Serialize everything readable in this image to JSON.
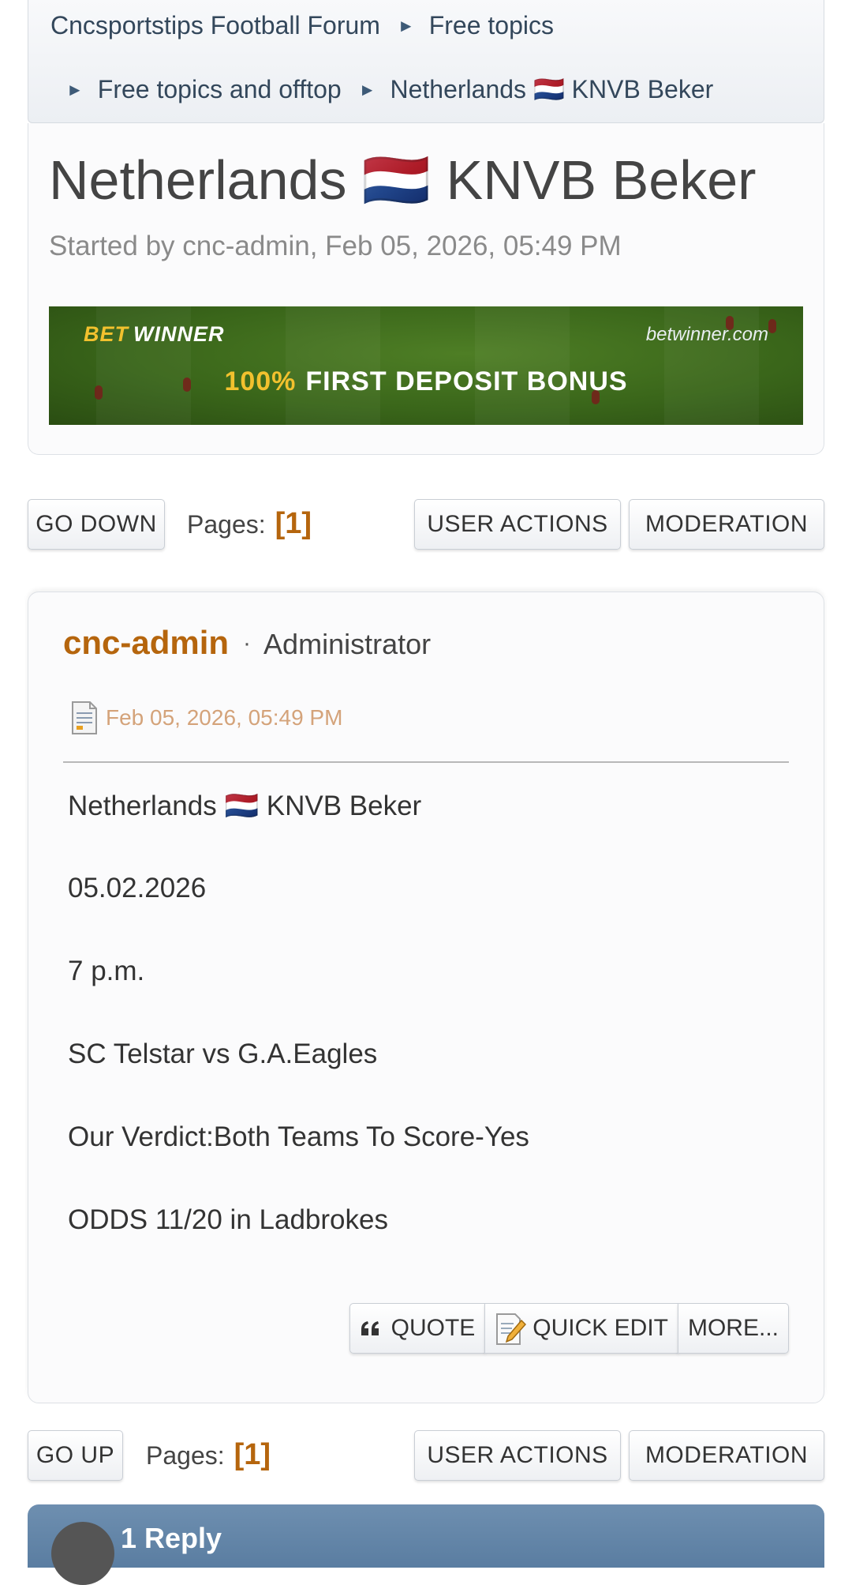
{
  "breadcrumb": {
    "separator": "►",
    "items": [
      "Cncsportstips Football Forum",
      "Free topics",
      "Free topics and offtop",
      "Netherlands 🇳🇱 KNVB Beker"
    ]
  },
  "topic": {
    "title": "Netherlands 🇳🇱 KNVB Beker",
    "meta": "Started by cnc-admin, Feb 05, 2026, 05:49 PM"
  },
  "banner": {
    "brand_a": "BET",
    "brand_b": "WINNER",
    "domain": "betwinner.com",
    "offer_highlight": "100%",
    "offer_text": "FIRST DEPOSIT BONUS"
  },
  "controls_top": {
    "nav_label": "GO DOWN",
    "pages_label": "Pages:",
    "current_page": "[1]",
    "user_actions": "USER ACTIONS",
    "moderation": "MODERATION"
  },
  "post": {
    "author": "cnc-admin",
    "separator": "·",
    "role": "Administrator",
    "date": "Feb 05, 2026, 05:49 PM",
    "body": [
      "Netherlands 🇳🇱 KNVB Beker",
      "05.02.2026",
      "7 p.m.",
      "SC Telstar vs G.A.Eagles",
      "Our Verdict:Both Teams To Score-Yes",
      "ODDS 11/20 in Ladbrokes"
    ],
    "actions": {
      "quote": "QUOTE",
      "quick_edit": "QUICK EDIT",
      "more": "MORE..."
    }
  },
  "controls_bottom": {
    "nav_label": "GO UP",
    "pages_label": "Pages:",
    "current_page": "[1]",
    "user_actions": "USER ACTIONS",
    "moderation": "MODERATION"
  },
  "replies": {
    "label": "1 Reply"
  },
  "colors": {
    "accent": "#b5650d",
    "date": "#d4a37a",
    "bar": "#5a7da1"
  }
}
